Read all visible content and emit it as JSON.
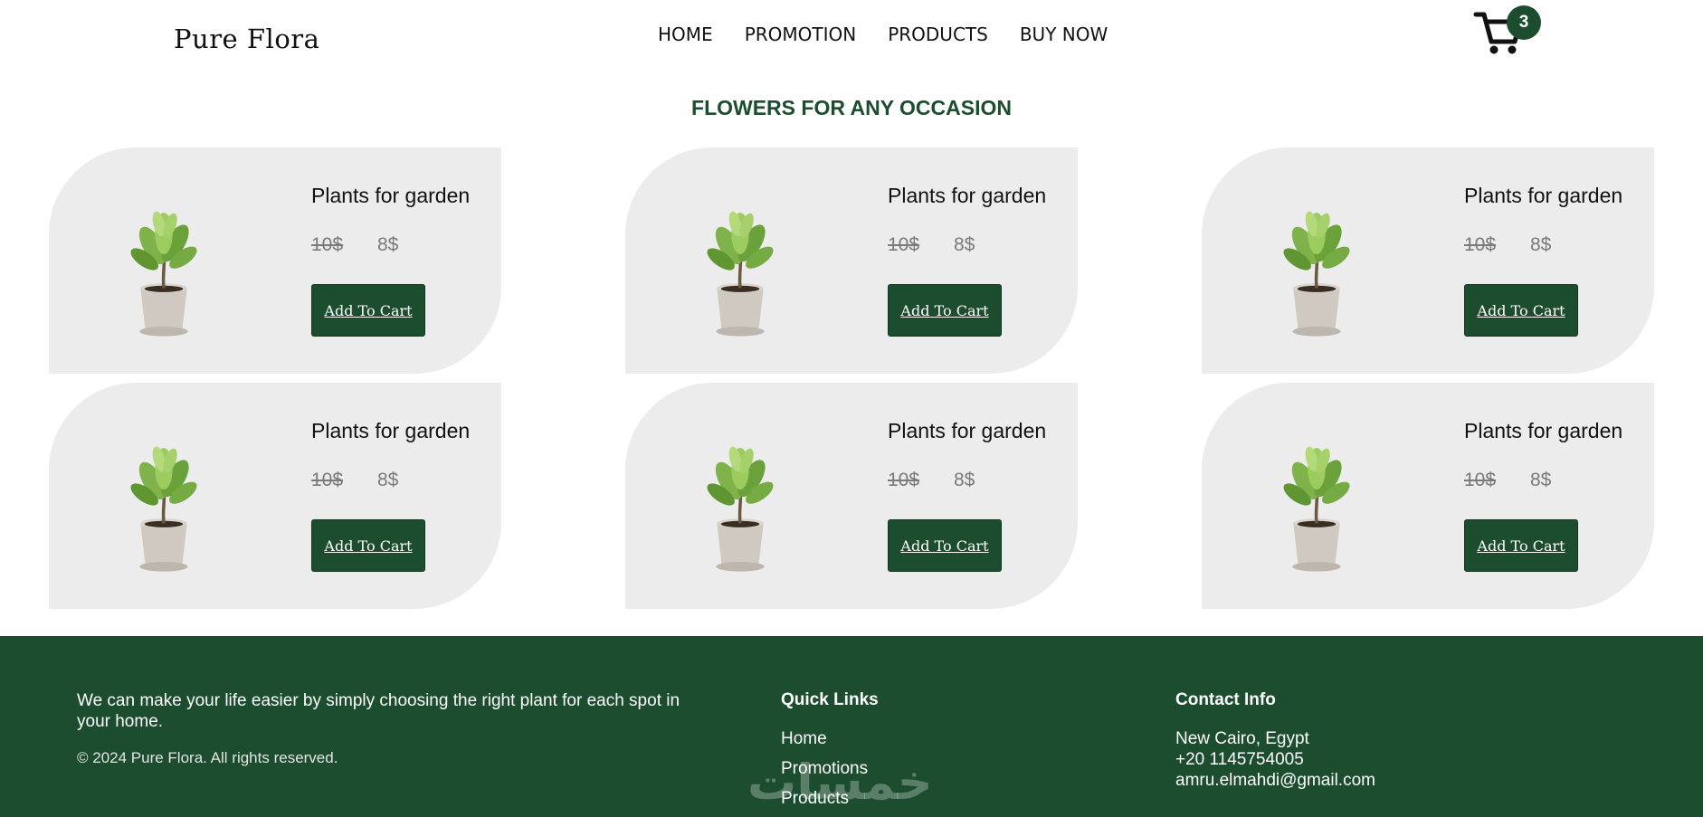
{
  "header": {
    "logo": "Pure Flora",
    "nav": [
      "HOME",
      "PROMOTION",
      "PRODUCTS",
      "BUY NOW"
    ],
    "cart_count": "3"
  },
  "section_title": "FLOWERS FOR ANY OCCASION",
  "products": [
    {
      "title": "Plants for garden",
      "old_price": "10$",
      "new_price": "8$",
      "button": "Add To Cart"
    },
    {
      "title": "Plants for garden",
      "old_price": "10$",
      "new_price": "8$",
      "button": "Add To Cart"
    },
    {
      "title": "Plants for garden",
      "old_price": "10$",
      "new_price": "8$",
      "button": "Add To Cart"
    },
    {
      "title": "Plants for garden",
      "old_price": "10$",
      "new_price": "8$",
      "button": "Add To Cart"
    },
    {
      "title": "Plants for garden",
      "old_price": "10$",
      "new_price": "8$",
      "button": "Add To Cart"
    },
    {
      "title": "Plants for garden",
      "old_price": "10$",
      "new_price": "8$",
      "button": "Add To Cart"
    }
  ],
  "footer": {
    "about": "We can make your life easier by simply choosing the right plant for each spot in your home.",
    "copyright": "© 2024 Pure Flora. All rights reserved.",
    "quick_links_title": "Quick Links",
    "quick_links": [
      "Home",
      "Promotions",
      "Products"
    ],
    "contact_title": "Contact Info",
    "address": "New Cairo, Egypt",
    "phone": "+20 1145754005",
    "email": "amru.elmahdi@gmail.com",
    "watermark": "خمسات"
  },
  "colors": {
    "brand_green": "#1b4d2e",
    "card_bg": "#ececec"
  }
}
